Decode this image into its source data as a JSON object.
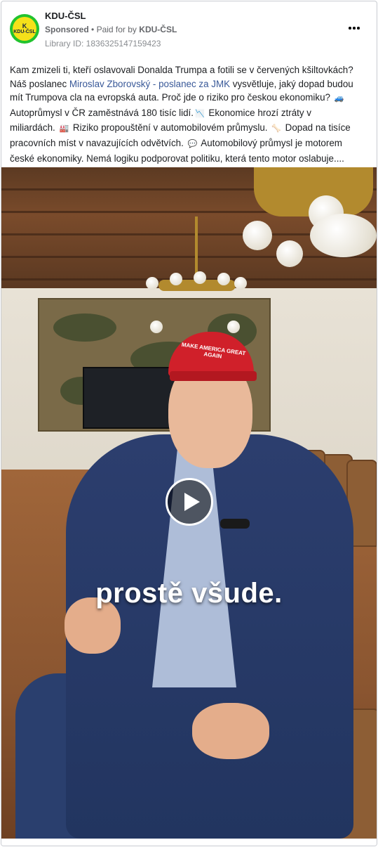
{
  "page": {
    "name": "KDU-ČSL",
    "sponsored_label": "Sponsored",
    "separator": "•",
    "paid_for_by_prefix": "Paid for by",
    "paid_for_by_name": "KDU-ČSL",
    "library_id": "Library ID: 1836325147159423",
    "logo_text": "KDU-ČSL",
    "logo_mark": "K",
    "brand_green": "#22c32e",
    "brand_yellow": "#f5e11a"
  },
  "post": {
    "line1": "Kam zmizeli ti, kteří oslavovali Donalda Trumpa a fotili se v červených kšiltovkách?",
    "line2_before_link": "Náš poslanec ",
    "line2_link": "Miroslav Zborovský - poslanec za JMK",
    "line2_after_link": " vysvětluje, jaký dopad budou",
    "line3": "mít Trumpova cla na evropská auta. Proč jde o riziko pro českou ekonomiku?",
    "line4_a": "Autoprůmysl v ČR zaměstnává 180 tisíc lidí.",
    "line4_b": " Ekonomice hrozí ztráty v",
    "line5_a": "miliardách.",
    "line5_b": " Riziko propouštění v automobilovém průmyslu.",
    "line5_c": " Dopad na tisíce",
    "line6_a": "pracovních míst v navazujících odvětvích.",
    "line6_b": " Automobilový průmysl je motorem",
    "line7": "české ekonomiky. Nemá logiku podporovat politiku, která tento motor oslabuje....",
    "emoji_car": "🚙",
    "emoji_chart": "📉",
    "emoji_factory": "🏭",
    "emoji_bone": "🦴",
    "emoji_speech": "💬"
  },
  "video": {
    "caption": "prostě všude.",
    "hat_text": "MAKE AMERICA GREAT AGAIN"
  },
  "icons": {
    "more": "more-horizontal-icon",
    "play": "play-icon"
  }
}
